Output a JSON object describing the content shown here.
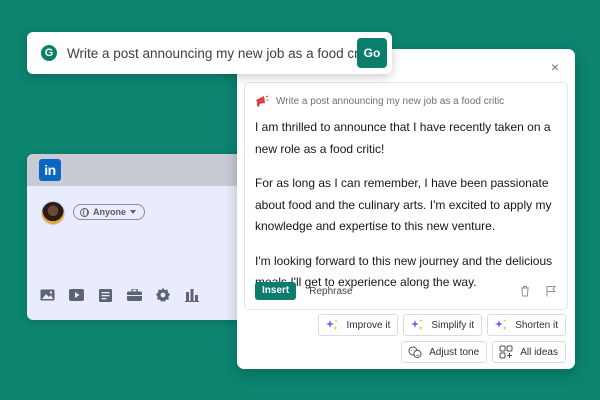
{
  "prompt_bar": {
    "logo_letter": "G",
    "text": "Write a post announcing my new job as a food critic",
    "go_label": "Go"
  },
  "linkedin": {
    "logo_text": "in",
    "audience_label": "Anyone",
    "tools": [
      "photo-icon",
      "video-icon",
      "document-icon",
      "briefcase-icon",
      "badge-icon",
      "chart-icon"
    ]
  },
  "panel": {
    "close_label": "×",
    "prompt_echo": "Write a post announcing my new job as a food critic",
    "paragraphs": [
      "I am thrilled to announce that I have recently taken on a new role as a food critic!",
      "For as long as I can remember, I have been passionate about food and the culinary arts. I'm excited to apply my knowledge and expertise to this new venture.",
      "I'm looking forward to this new journey and the delicious meals I'll get to experience along the way."
    ],
    "insert_label": "Insert",
    "rephrase_label": "Rephrase"
  },
  "chips": {
    "improve": "Improve it",
    "simplify": "Simplify it",
    "shorten": "Shorten it",
    "adjust_tone": "Adjust tone",
    "all_ideas": "All ideas"
  },
  "colors": {
    "background": "#0c8470",
    "accent": "#0b7d6b",
    "linkedin_blue": "#0a66c2",
    "sparkle_purple": "#7b5cf0",
    "sparkle_yellow": "#f5b800"
  }
}
